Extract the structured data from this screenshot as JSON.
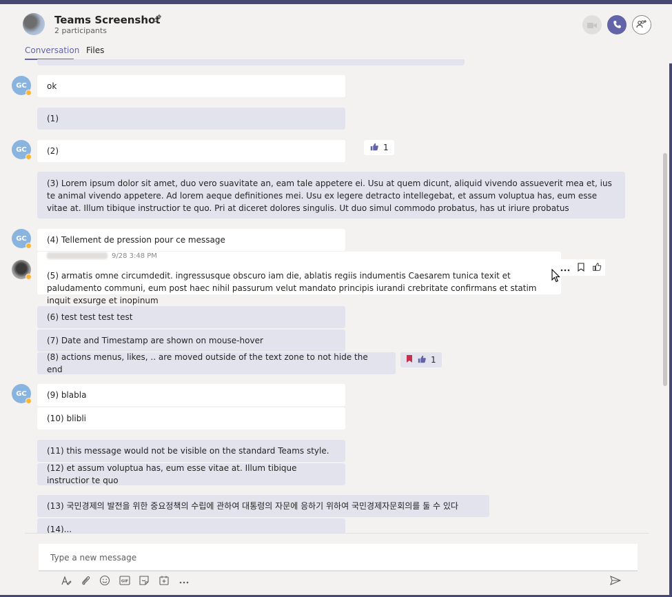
{
  "header": {
    "title": "Teams Screenshot",
    "participants": "2 participants"
  },
  "tabs": [
    {
      "label": "Conversation",
      "active": true
    },
    {
      "label": "Files",
      "active": false
    }
  ],
  "avatars": {
    "gc_initials": "GC"
  },
  "messages": {
    "m0": "ok",
    "m1": "(1)",
    "m2": "(2)",
    "m3": "(3) Lorem ipsum dolor sit amet, duo vero suavitate an, eam tale appetere ei. Usu at quem dicunt, aliquid vivendo assueverit mea et, ius te animal vivendo appetere. Ad lorem aeque definitiones mei. Usu ex legere detracto intellegebat, et assum voluptua has, eum esse vitae at. Illum tibique instructior te quo. Pri at diceret dolores singulis. Ut duo simul commodo probatus, has ut iriure probatus",
    "m4": "(4) Tellement de pression pour ce message",
    "m5": "(5) armatis omne circumdedit. ingressusque obscuro iam die, ablatis regiis indumentis Caesarem tunica texit et paludamento communi, eum post haec nihil passurum velut mandato principis iurandi crebritate confirmans et statim inquit exsurge et inopinum",
    "m6": "(6) test test test test",
    "m7": "(7) Date and Timestamp are shown on mouse-hover",
    "m8": "(8) actions menus, likes, .. are moved outside of the text zone to not hide the end",
    "m9": "(9) blabla",
    "m10": "(10) blibli",
    "m11": "(11) this message would not be visible on the standard Teams style.",
    "m12": "(12) et assum voluptua has, eum esse vitae at. Illum tibique instructior te quo",
    "m13": "(13) 국민경제의 발전을 위한 중요정책의 수립에 관하여 대통령의 자문에 응하기 위하여 국민경제자문회의를 둘 수 있다",
    "m14": "(14)..."
  },
  "timestamp_m5": "9/28 3:48 PM",
  "reactions": {
    "m2_likes": "1",
    "m8_likes": "1"
  },
  "compose": {
    "placeholder": "Type a new message"
  },
  "colors": {
    "accent": "#6264a7",
    "frame": "#464775",
    "bubble_self": "#e3e3ed",
    "bubble_other": "#ffffff",
    "bookmark": "#c4314b",
    "presence_away": "#f8b73b"
  },
  "icons": [
    "pencil-icon",
    "video-icon",
    "phone-icon",
    "add-people-icon",
    "thumbs-up-icon",
    "bookmark-icon",
    "more-icon",
    "format-icon",
    "attach-icon",
    "emoji-icon",
    "gif-icon",
    "sticker-icon",
    "meet-icon",
    "send-icon"
  ]
}
